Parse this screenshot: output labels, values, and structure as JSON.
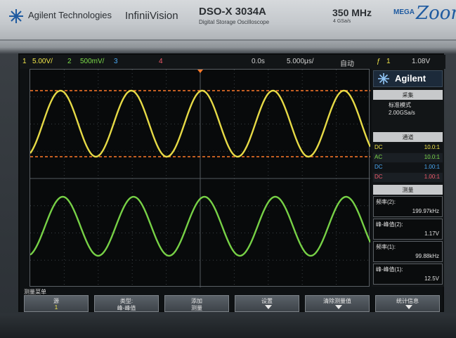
{
  "header": {
    "brand": "Agilent Technologies",
    "product": "InfiniiVision",
    "model": "DSO-X 3034A",
    "model_desc": "Digital Storage Oscilloscope",
    "bandwidth": "350 MHz",
    "sample_rate": "4 GSa/s",
    "mega": "MEGA",
    "zoom": "Zoom"
  },
  "status": {
    "ch1_num": "1",
    "ch1_scale": "5.00V/",
    "ch2_num": "2",
    "ch2_scale": "500mV/",
    "ch3_num": "3",
    "ch4_num": "4",
    "time_pos": "0.0s",
    "time_scale": "5.000μs/",
    "trig_mode": "自动",
    "trig_source": "1",
    "trig_level": "1.08V",
    "colors": {
      "ch1": "#f2e64a",
      "ch2": "#7ddc4a",
      "ch3": "#4aa8f2",
      "ch4": "#f25a6a",
      "trig_line": "#ff7a2a"
    }
  },
  "panel": {
    "logo": "Agilent",
    "acq_title": "采集",
    "acq_mode": "标准模式",
    "acq_rate": "2.00GSa/s",
    "ch_title": "通道",
    "channels": [
      {
        "coupling": "DC",
        "probe": "10.0:1",
        "color": "#f2e64a"
      },
      {
        "coupling": "AC",
        "probe": "10.0:1",
        "color": "#7ddc4a"
      },
      {
        "coupling": "DC",
        "probe": "1.00:1",
        "color": "#4aa8f2"
      },
      {
        "coupling": "DC",
        "probe": "1.00:1",
        "color": "#f25a6a"
      }
    ],
    "meas_title": "测量",
    "measurements": [
      {
        "label": "频率(2):",
        "value": "199.97kHz"
      },
      {
        "label": "峰-峰值(2):",
        "value": "1.17V"
      },
      {
        "label": "频率(1):",
        "value": "99.88kHz"
      },
      {
        "label": "峰-峰值(1):",
        "value": "12.5V"
      }
    ]
  },
  "softkeys": {
    "menu_label": "测量菜单",
    "keys": [
      {
        "top": "源",
        "bottom": "1"
      },
      {
        "top": "类型:",
        "bottom": "峰-峰值"
      },
      {
        "top": "添加",
        "bottom": "测量"
      },
      {
        "top": "设置",
        "bottom": ""
      },
      {
        "top": "清除测量值",
        "bottom": ""
      },
      {
        "top": "统计信息",
        "bottom": ""
      }
    ]
  }
}
